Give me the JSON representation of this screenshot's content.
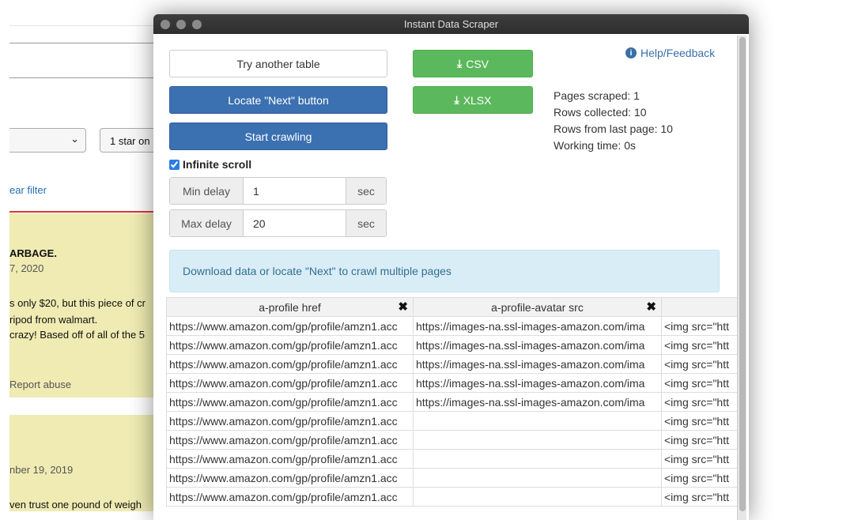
{
  "background": {
    "filter_select_chevron": "chevron-down-icon",
    "star_filter": "1 star on",
    "clear_filter": "ear filter",
    "review1": {
      "title": "ARBAGE.",
      "date": "7, 2020",
      "lines": [
        "s only $20, but this piece of cr",
        "ripod from walmart.",
        "crazy! Based off of all of the 5"
      ],
      "report": "Report abuse"
    },
    "review2": {
      "date": "nber 19, 2019",
      "line": "ven trust one pound of weigh"
    }
  },
  "window": {
    "title": "Instant Data Scraper"
  },
  "buttons": {
    "try_another": "Try another table",
    "locate_next": "Locate \"Next\" button",
    "start_crawling": "Start crawling",
    "csv": "CSV",
    "xlsx": "XLSX",
    "help": "Help/Feedback"
  },
  "colors": {
    "blue": "#3b70b1",
    "green": "#5cb85c",
    "info_bg": "#d9edf7"
  },
  "options": {
    "infinite_scroll": "Infinite scroll",
    "infinite_scroll_checked": true,
    "min_delay_label": "Min delay",
    "min_delay": "1",
    "max_delay_label": "Max delay",
    "max_delay": "20",
    "unit": "sec"
  },
  "stats": {
    "pages": "Pages scraped: 1",
    "rows": "Rows collected: 10",
    "last": "Rows from last page: 10",
    "time": "Working time: 0s"
  },
  "alert": "Download data or locate \"Next\" to crawl multiple pages",
  "table": {
    "headers": [
      "a-profile href",
      "a-profile-avatar src",
      ""
    ],
    "rows": [
      [
        "https://www.amazon.com/gp/profile/amzn1.acc",
        "https://images-na.ssl-images-amazon.com/ima",
        "<img src=\"htt"
      ],
      [
        "https://www.amazon.com/gp/profile/amzn1.acc",
        "https://images-na.ssl-images-amazon.com/ima",
        "<img src=\"htt"
      ],
      [
        "https://www.amazon.com/gp/profile/amzn1.acc",
        "https://images-na.ssl-images-amazon.com/ima",
        "<img src=\"htt"
      ],
      [
        "https://www.amazon.com/gp/profile/amzn1.acc",
        "https://images-na.ssl-images-amazon.com/ima",
        "<img src=\"htt"
      ],
      [
        "https://www.amazon.com/gp/profile/amzn1.acc",
        "https://images-na.ssl-images-amazon.com/ima",
        "<img src=\"htt"
      ],
      [
        "https://www.amazon.com/gp/profile/amzn1.acc",
        "",
        "<img src=\"htt"
      ],
      [
        "https://www.amazon.com/gp/profile/amzn1.acc",
        "",
        "<img src=\"htt"
      ],
      [
        "https://www.amazon.com/gp/profile/amzn1.acc",
        "",
        "<img src=\"htt"
      ],
      [
        "https://www.amazon.com/gp/profile/amzn1.acc",
        "",
        "<img src=\"htt"
      ],
      [
        "https://www.amazon.com/gp/profile/amzn1.acc",
        "",
        "<img src=\"htt"
      ]
    ]
  }
}
